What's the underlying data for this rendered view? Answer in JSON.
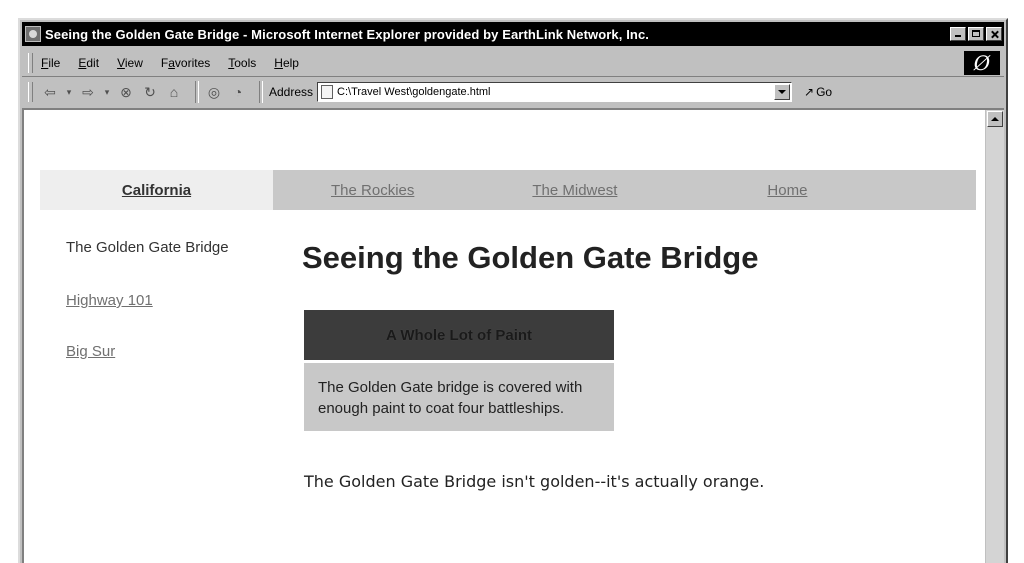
{
  "window": {
    "title": "Seeing the Golden Gate Bridge - Microsoft Internet Explorer provided by EarthLink Network, Inc."
  },
  "menubar": {
    "items": [
      {
        "accel": "F",
        "rest": "ile"
      },
      {
        "accel": "E",
        "rest": "dit"
      },
      {
        "accel": "V",
        "rest": "iew"
      },
      {
        "pre": "F",
        "accel": "a",
        "rest": "vorites"
      },
      {
        "accel": "T",
        "rest": "ools"
      },
      {
        "accel": "H",
        "rest": "elp"
      }
    ]
  },
  "toolbar": {
    "address_label": "Address",
    "address_value": "C:\\Travel West\\goldengate.html",
    "go_label": "Go"
  },
  "nav": {
    "california": "California",
    "rockies": "The Rockies",
    "midwest": "The Midwest",
    "home": "Home"
  },
  "sidebar": {
    "current": "The Golden Gate Bridge",
    "link1": "Highway 101",
    "link2": "Big Sur"
  },
  "page": {
    "title": "Seeing the Golden Gate Bridge",
    "callout_title": "A Whole Lot of Paint",
    "callout_body": "The Golden Gate bridge is covered with enough paint to coat four battleships.",
    "body_text": "The Golden Gate Bridge isn't golden--it's actually orange."
  }
}
